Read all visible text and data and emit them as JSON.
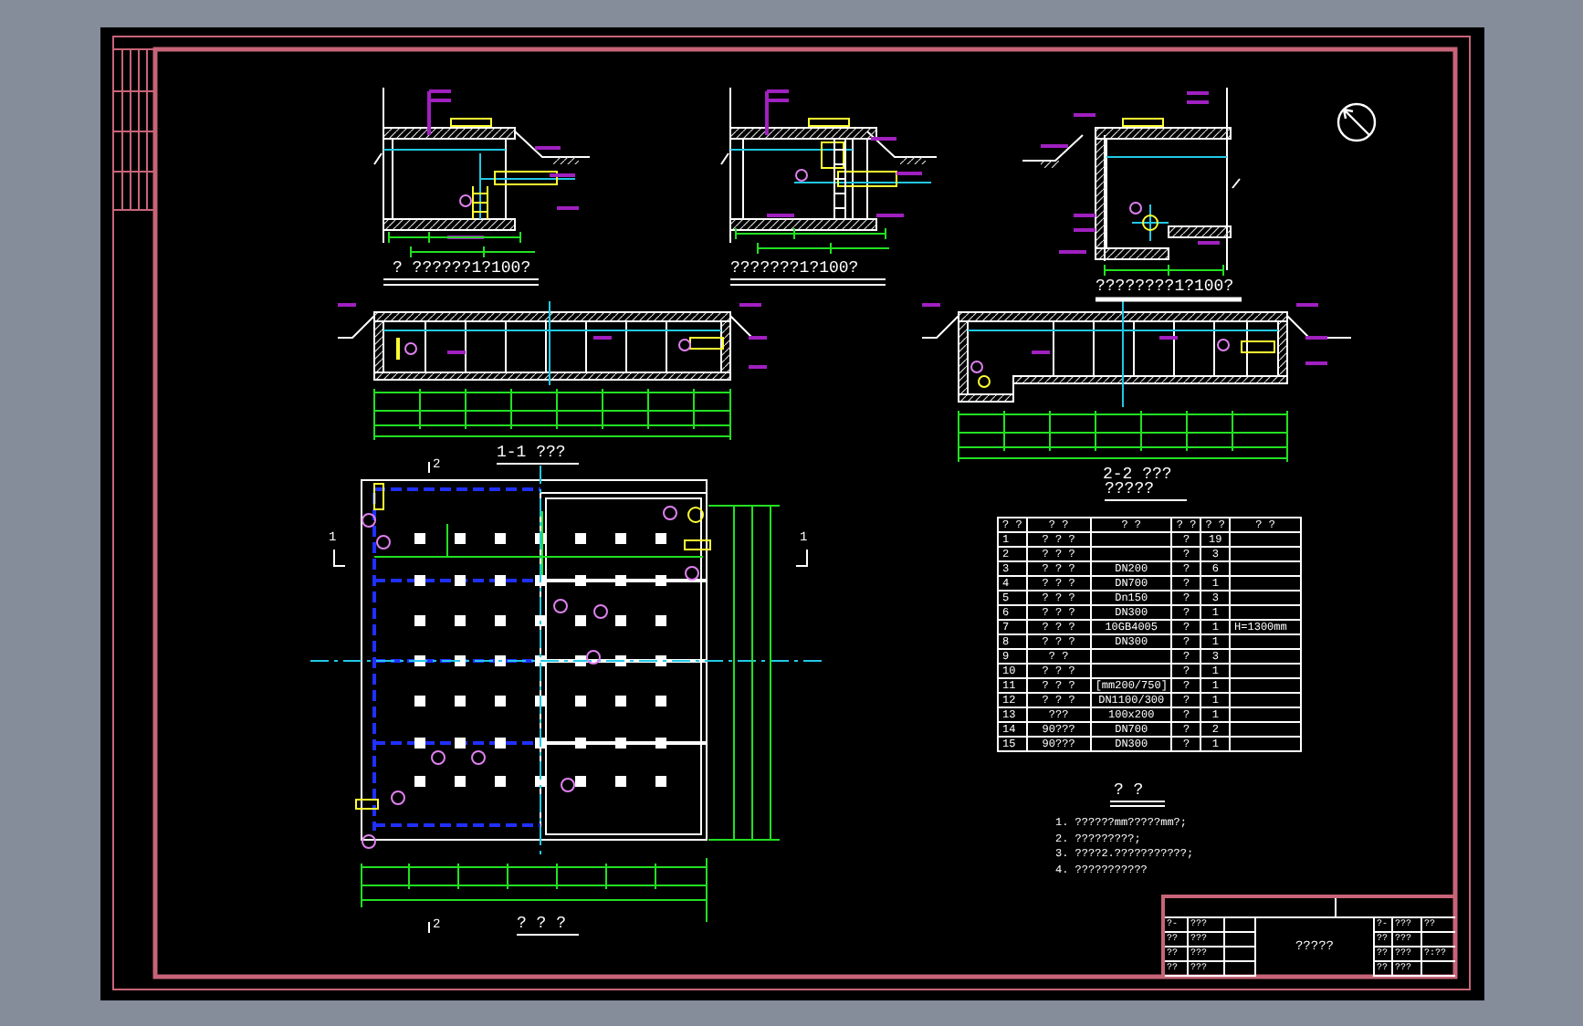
{
  "details": [
    {
      "kind": "side-pipe",
      "title": "? ??????1?100?"
    },
    {
      "kind": "ladder",
      "title": "???????1?100?"
    },
    {
      "kind": "sump",
      "title": "????????1?100?"
    }
  ],
  "long_sections": [
    {
      "kind": "flat",
      "title": "1-1 ???"
    },
    {
      "kind": "step",
      "title": "2-2 ???"
    }
  ],
  "plan": {
    "title": "? ? ?",
    "cut_marks": [
      "2",
      "2",
      "1",
      "1"
    ]
  },
  "table": {
    "title": "?????",
    "columns": [
      "? ?",
      "?   ?",
      "?   ?",
      "? ?",
      "? ?",
      "?   ?"
    ],
    "rows": [
      [
        "1",
        "? ? ?",
        "",
        "?",
        "19",
        ""
      ],
      [
        "2",
        "? ? ?",
        "",
        "?",
        "3",
        ""
      ],
      [
        "3",
        "? ? ?",
        "DN200",
        "?",
        "6",
        ""
      ],
      [
        "4",
        "? ? ?",
        "DN700",
        "?",
        "1",
        ""
      ],
      [
        "5",
        "? ? ?",
        "Dn150",
        "?",
        "3",
        ""
      ],
      [
        "6",
        "? ? ?",
        "DN300",
        "?",
        "1",
        ""
      ],
      [
        "7",
        "? ? ?",
        "10GB4005",
        "?",
        "1",
        "H=1300mm"
      ],
      [
        "8",
        "? ? ?",
        "DN300",
        "?",
        "1",
        ""
      ],
      [
        "9",
        "?    ?",
        "",
        "?",
        "3",
        ""
      ],
      [
        "10",
        "? ? ?",
        "",
        "?",
        "1",
        ""
      ],
      [
        "11",
        "? ? ?",
        "[mm200/750]",
        "?",
        "1",
        ""
      ],
      [
        "12",
        "? ? ?",
        "DN1100/300",
        "?",
        "1",
        ""
      ],
      [
        "13",
        "???",
        "100x200",
        "?",
        "1",
        ""
      ],
      [
        "14",
        "90???",
        "DN700",
        "?",
        "2",
        ""
      ],
      [
        "15",
        "90???",
        "DN300",
        "?",
        "1",
        ""
      ]
    ]
  },
  "notes": {
    "title": "? ?",
    "items": [
      "1. ??????mm?????mm?;",
      "2. ?????????;",
      "3. ????2.???????????;",
      "4. ???????????"
    ]
  },
  "title_block": {
    "title": "?????",
    "left_rows": [
      [
        "?-",
        "???"
      ],
      [
        "??",
        "???"
      ],
      [
        "??",
        "???"
      ],
      [
        "??",
        "???"
      ]
    ],
    "right_rows": [
      [
        "?-",
        "???",
        "??"
      ],
      [
        "??",
        "???"
      ],
      [
        "??",
        "???",
        "?:??"
      ],
      [
        "??",
        "???"
      ]
    ]
  }
}
